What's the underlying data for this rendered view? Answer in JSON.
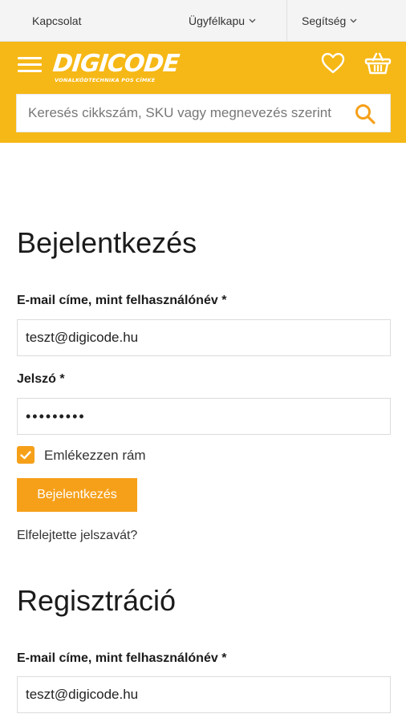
{
  "topbar": {
    "contact": "Kapcsolat",
    "portal": "Ügyfélkapu",
    "help": "Segítség"
  },
  "header": {
    "logo_text": "DIGICODE",
    "logo_tagline": "VONALKÓDTECHNIKA POS CÍMKE",
    "search_placeholder": "Keresés cikkszám, SKU vagy megnevezés szerint",
    "accent_color": "#f6b816"
  },
  "login": {
    "title": "Bejelentkezés",
    "email_label": "E-mail címe, mint felhasználónév *",
    "email_value": "teszt@digicode.hu",
    "password_label": "Jelszó *",
    "password_value": "•••••••••",
    "remember_label": "Emlékezzen rám",
    "submit_label": "Bejelentkezés",
    "forgot_link": "Elfelejtette jelszavát?",
    "button_color": "#f6a01a"
  },
  "register": {
    "title": "Regisztráció",
    "email_label": "E-mail címe, mint felhasználónév *",
    "email_value": "teszt@digicode.hu"
  }
}
